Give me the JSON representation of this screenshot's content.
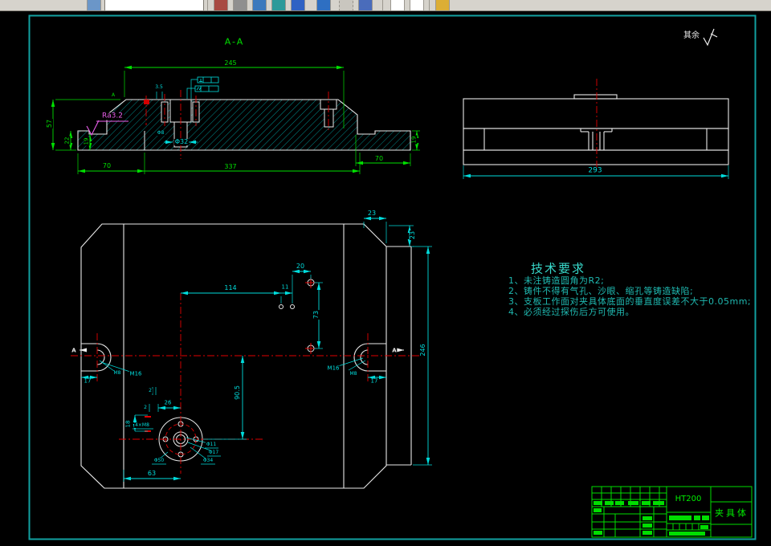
{
  "toolbar": {
    "icons": [
      "table-icon",
      "pencil-icon",
      "eraser-icon",
      "layers-icon",
      "hatch-icon",
      "arrow-down-icon",
      "rotate-icon",
      "selection-icon",
      "block-icon",
      "page-icon",
      "page-icon-2",
      "flag-icon"
    ],
    "combo_value": ""
  },
  "colors": {
    "frame": "#12a0a0",
    "dim_green": "#00e000",
    "dim_cyan": "#00dcdc",
    "centerline_red": "#e00000",
    "surface_magenta": "#ea5fea",
    "title_block_green": "#00ee00"
  },
  "surface_note": {
    "label": "其余"
  },
  "views": {
    "section": {
      "title": "A-A",
      "dim_245": "245",
      "dim_337": "337",
      "dim_70_left": "70",
      "dim_70_right": "70",
      "dim_22": "22",
      "dim_19_left": "19",
      "dim_19_right": "19",
      "dim_57": "57",
      "surface_finish": "Ra3.2",
      "dia_32": "Φ32",
      "dim_3_5": "3.5",
      "dia_8": "Φ8",
      "datum": "A"
    },
    "side": {
      "dim_293": "293"
    },
    "plan": {
      "dim_23_top": "23",
      "dim_23_right": "23",
      "dim_246": "246",
      "dim_114": "114",
      "dim_11": "11",
      "dim_20": "20",
      "dim_73": "73",
      "dim_90_5": "90.5",
      "dim_26": "26",
      "dim_2a": "2",
      "dim_2b": "2",
      "dim_18": "18",
      "dim_63": "63",
      "dim_17_left": "17",
      "dim_17_right": "17",
      "thread_m8_left": "M8",
      "thread_m16_left": "M16",
      "thread_m16_right": "M16",
      "thread_m8_right": "M8",
      "dia_11": "Φ11",
      "dia_17": "Φ17",
      "dia_34": "Φ34",
      "dia_50": "Φ50",
      "callout_4m8": "4×M8",
      "marker_a_left": "A",
      "marker_a_right": "A"
    }
  },
  "tech_requirements": {
    "title": "技术要求",
    "items": [
      "1、未注铸造圆角为R2;",
      "2、铸件不得有气孔、沙眼、缩孔等铸造缺陷;",
      "3、支板工作面对夹具体底面的垂直度误差不大于0.05mm;",
      "4、必须经过探伤后方可使用。"
    ]
  },
  "title_block": {
    "material": "HT200",
    "part_name": "夹具体"
  }
}
